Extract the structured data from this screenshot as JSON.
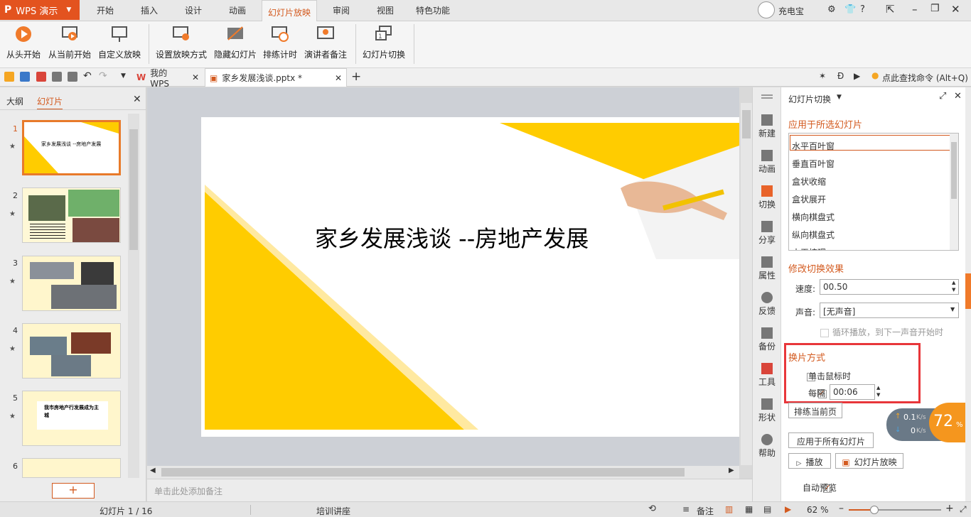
{
  "app": {
    "name": "WPS 演示",
    "logo_glyph": "P"
  },
  "menu": {
    "tabs": [
      "开始",
      "插入",
      "设计",
      "动画",
      "幻灯片放映",
      "审阅",
      "视图",
      "特色功能"
    ],
    "active": "幻灯片放映"
  },
  "user": {
    "name": "充电宝"
  },
  "ribbon": {
    "buttons": [
      "从头开始",
      "从当前开始",
      "自定义放映",
      "设置放映方式",
      "隐藏幻灯片",
      "排练计时",
      "演讲者备注",
      "幻灯片切换"
    ]
  },
  "tabs_bar": {
    "home_tab": "我的WPS",
    "doc_tab": "家乡发展浅谈.pptx *",
    "search": "点此查找命令 (Alt+Q)"
  },
  "left_panel": {
    "tabs": [
      "大纲",
      "幻灯片"
    ],
    "slides": [
      {
        "num": "1",
        "caption": "家乡发展浅谈 --房地产发展"
      },
      {
        "num": "2",
        "caption": ""
      },
      {
        "num": "3",
        "caption": ""
      },
      {
        "num": "4",
        "caption": ""
      },
      {
        "num": "5",
        "caption": "我市房地产行发展成为主城"
      },
      {
        "num": "6",
        "caption": ""
      }
    ]
  },
  "slide": {
    "title": "家乡发展浅谈 --房地产发展"
  },
  "notes": {
    "placeholder": "单击此处添加备注"
  },
  "right_bar": [
    "新建",
    "动画",
    "切换",
    "分享",
    "属性",
    "反馈",
    "备份",
    "工具",
    "形状",
    "帮助"
  ],
  "pane": {
    "header": "幻灯片切换",
    "apply_label": "应用于所选幻灯片",
    "effects": [
      "水平百叶窗",
      "垂直百叶窗",
      "盒状收缩",
      "盒状展开",
      "横向棋盘式",
      "纵向棋盘式",
      "水平梳理"
    ],
    "modify_label": "修改切换效果",
    "speed_label": "速度:",
    "speed_value": "00.50",
    "sound_label": "声音:",
    "sound_value": "[无声音]",
    "loop_label": "循环播放，到下一声音开始时",
    "advance_label": "换片方式",
    "on_click_label": "单击鼠标时",
    "every_label": "每隔",
    "every_value": "00:06",
    "rehearse_button": "排练当前页",
    "apply_all_button": "应用于所有幻灯片",
    "play_button": "播放",
    "slideshow_button": "幻灯片放映",
    "auto_preview_label": "自动预览"
  },
  "net": {
    "up": "0.1",
    "down": "0",
    "unit": "K/s",
    "percent": "72",
    "percent_sign": "%"
  },
  "status": {
    "slide_info": "幻灯片 1 / 16",
    "theme": "培训讲座",
    "notes": "备注",
    "zoom": "62 %"
  },
  "colors": {
    "accent": "#d35a1f",
    "yellow": "#ffcc00",
    "highlight_box": "#e8363a"
  }
}
